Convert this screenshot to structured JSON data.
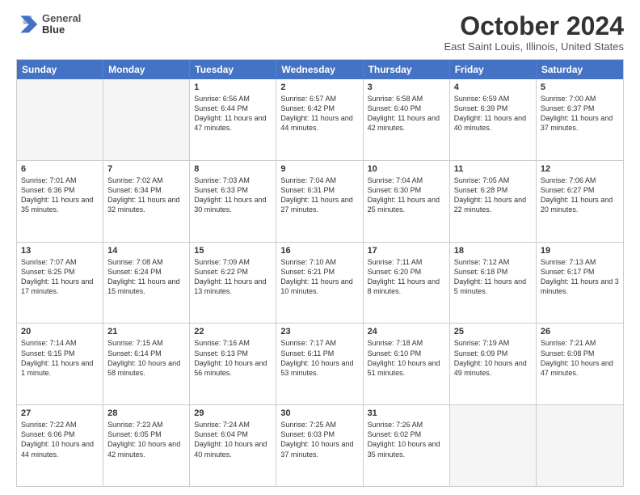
{
  "header": {
    "logo_line1": "General",
    "logo_line2": "Blue",
    "month_title": "October 2024",
    "location": "East Saint Louis, Illinois, United States"
  },
  "days_of_week": [
    "Sunday",
    "Monday",
    "Tuesday",
    "Wednesday",
    "Thursday",
    "Friday",
    "Saturday"
  ],
  "weeks": [
    [
      {
        "day": "",
        "info": ""
      },
      {
        "day": "",
        "info": ""
      },
      {
        "day": "1",
        "info": "Sunrise: 6:56 AM\nSunset: 6:44 PM\nDaylight: 11 hours and 47 minutes."
      },
      {
        "day": "2",
        "info": "Sunrise: 6:57 AM\nSunset: 6:42 PM\nDaylight: 11 hours and 44 minutes."
      },
      {
        "day": "3",
        "info": "Sunrise: 6:58 AM\nSunset: 6:40 PM\nDaylight: 11 hours and 42 minutes."
      },
      {
        "day": "4",
        "info": "Sunrise: 6:59 AM\nSunset: 6:39 PM\nDaylight: 11 hours and 40 minutes."
      },
      {
        "day": "5",
        "info": "Sunrise: 7:00 AM\nSunset: 6:37 PM\nDaylight: 11 hours and 37 minutes."
      }
    ],
    [
      {
        "day": "6",
        "info": "Sunrise: 7:01 AM\nSunset: 6:36 PM\nDaylight: 11 hours and 35 minutes."
      },
      {
        "day": "7",
        "info": "Sunrise: 7:02 AM\nSunset: 6:34 PM\nDaylight: 11 hours and 32 minutes."
      },
      {
        "day": "8",
        "info": "Sunrise: 7:03 AM\nSunset: 6:33 PM\nDaylight: 11 hours and 30 minutes."
      },
      {
        "day": "9",
        "info": "Sunrise: 7:04 AM\nSunset: 6:31 PM\nDaylight: 11 hours and 27 minutes."
      },
      {
        "day": "10",
        "info": "Sunrise: 7:04 AM\nSunset: 6:30 PM\nDaylight: 11 hours and 25 minutes."
      },
      {
        "day": "11",
        "info": "Sunrise: 7:05 AM\nSunset: 6:28 PM\nDaylight: 11 hours and 22 minutes."
      },
      {
        "day": "12",
        "info": "Sunrise: 7:06 AM\nSunset: 6:27 PM\nDaylight: 11 hours and 20 minutes."
      }
    ],
    [
      {
        "day": "13",
        "info": "Sunrise: 7:07 AM\nSunset: 6:25 PM\nDaylight: 11 hours and 17 minutes."
      },
      {
        "day": "14",
        "info": "Sunrise: 7:08 AM\nSunset: 6:24 PM\nDaylight: 11 hours and 15 minutes."
      },
      {
        "day": "15",
        "info": "Sunrise: 7:09 AM\nSunset: 6:22 PM\nDaylight: 11 hours and 13 minutes."
      },
      {
        "day": "16",
        "info": "Sunrise: 7:10 AM\nSunset: 6:21 PM\nDaylight: 11 hours and 10 minutes."
      },
      {
        "day": "17",
        "info": "Sunrise: 7:11 AM\nSunset: 6:20 PM\nDaylight: 11 hours and 8 minutes."
      },
      {
        "day": "18",
        "info": "Sunrise: 7:12 AM\nSunset: 6:18 PM\nDaylight: 11 hours and 5 minutes."
      },
      {
        "day": "19",
        "info": "Sunrise: 7:13 AM\nSunset: 6:17 PM\nDaylight: 11 hours and 3 minutes."
      }
    ],
    [
      {
        "day": "20",
        "info": "Sunrise: 7:14 AM\nSunset: 6:15 PM\nDaylight: 11 hours and 1 minute."
      },
      {
        "day": "21",
        "info": "Sunrise: 7:15 AM\nSunset: 6:14 PM\nDaylight: 10 hours and 58 minutes."
      },
      {
        "day": "22",
        "info": "Sunrise: 7:16 AM\nSunset: 6:13 PM\nDaylight: 10 hours and 56 minutes."
      },
      {
        "day": "23",
        "info": "Sunrise: 7:17 AM\nSunset: 6:11 PM\nDaylight: 10 hours and 53 minutes."
      },
      {
        "day": "24",
        "info": "Sunrise: 7:18 AM\nSunset: 6:10 PM\nDaylight: 10 hours and 51 minutes."
      },
      {
        "day": "25",
        "info": "Sunrise: 7:19 AM\nSunset: 6:09 PM\nDaylight: 10 hours and 49 minutes."
      },
      {
        "day": "26",
        "info": "Sunrise: 7:21 AM\nSunset: 6:08 PM\nDaylight: 10 hours and 47 minutes."
      }
    ],
    [
      {
        "day": "27",
        "info": "Sunrise: 7:22 AM\nSunset: 6:06 PM\nDaylight: 10 hours and 44 minutes."
      },
      {
        "day": "28",
        "info": "Sunrise: 7:23 AM\nSunset: 6:05 PM\nDaylight: 10 hours and 42 minutes."
      },
      {
        "day": "29",
        "info": "Sunrise: 7:24 AM\nSunset: 6:04 PM\nDaylight: 10 hours and 40 minutes."
      },
      {
        "day": "30",
        "info": "Sunrise: 7:25 AM\nSunset: 6:03 PM\nDaylight: 10 hours and 37 minutes."
      },
      {
        "day": "31",
        "info": "Sunrise: 7:26 AM\nSunset: 6:02 PM\nDaylight: 10 hours and 35 minutes."
      },
      {
        "day": "",
        "info": ""
      },
      {
        "day": "",
        "info": ""
      }
    ]
  ]
}
